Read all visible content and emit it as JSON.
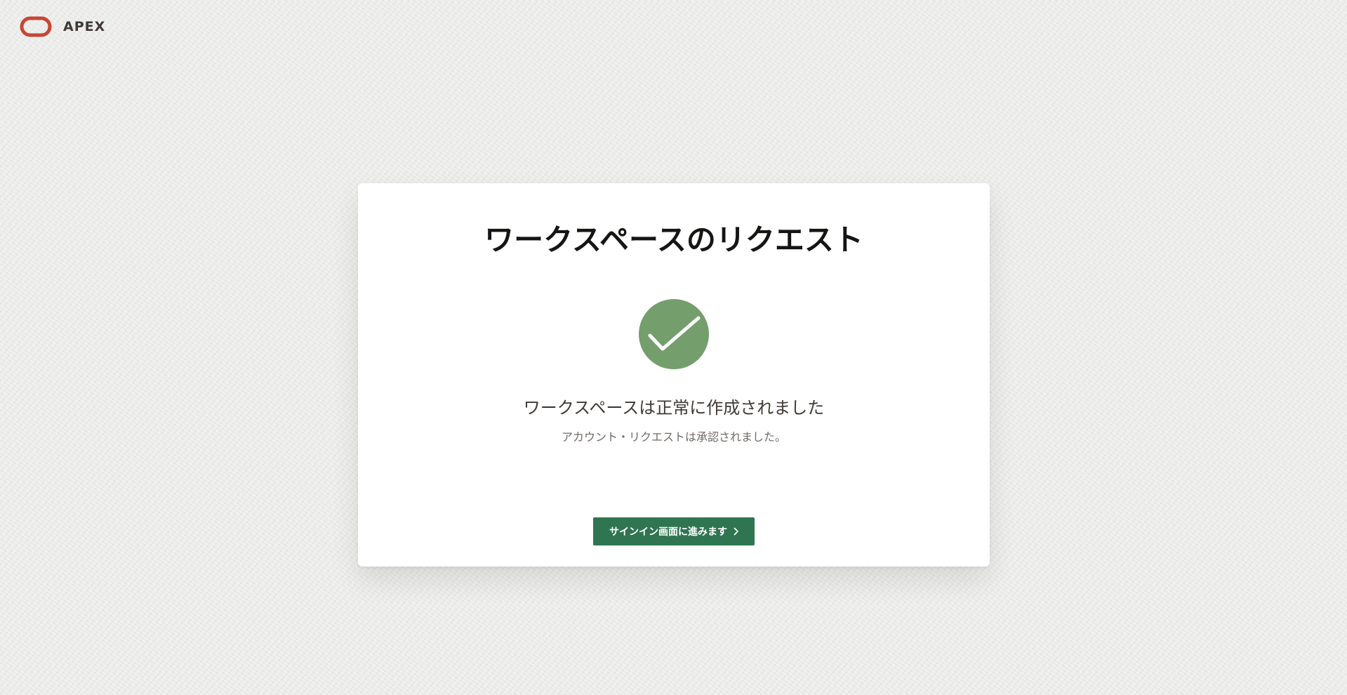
{
  "header": {
    "brand_name": "APEX",
    "logo_icon": "oracle-logo-icon",
    "logo_color": "#c74634"
  },
  "card": {
    "title": "ワークスペースのリクエスト",
    "status_icon": "check-circle-icon",
    "status_color": "#749e6c",
    "message_main": "ワークスペースは正常に作成されました",
    "message_sub": "アカウント・リクエストは承認されました。",
    "signin_button_label": "サインイン画面に進みます",
    "signin_button_icon": "chevron-right-icon",
    "button_color": "#2f7551"
  }
}
